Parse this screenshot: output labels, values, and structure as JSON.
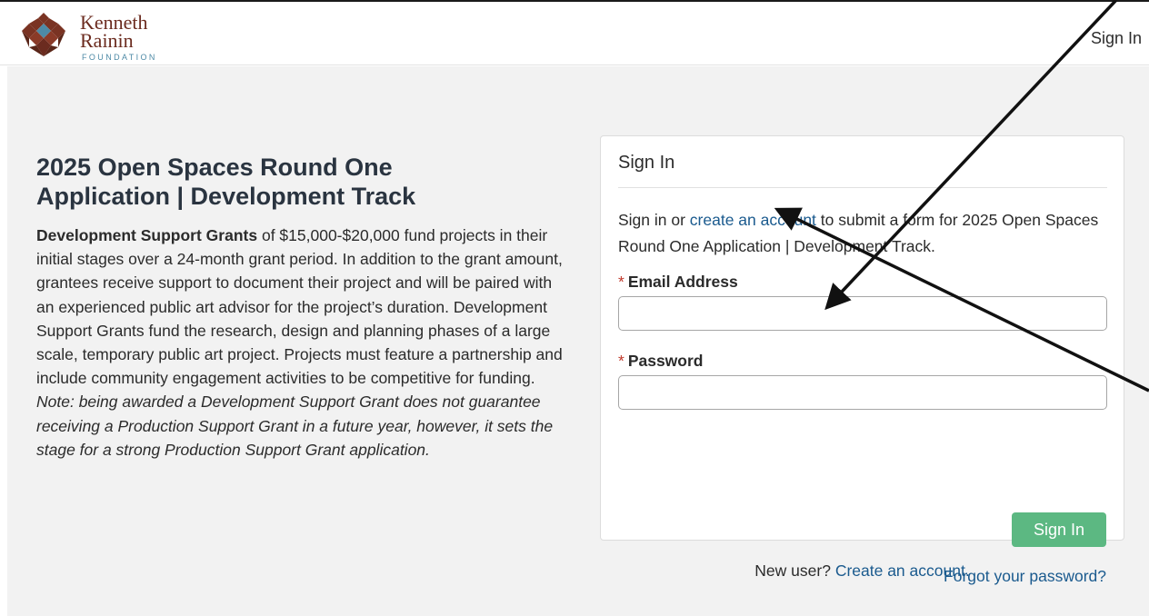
{
  "header": {
    "logo": {
      "line1": "Kenneth",
      "line2": "Rainin",
      "line3": "FOUNDATION"
    },
    "signin_link": "Sign In"
  },
  "main": {
    "title_line1": "2025 Open Spaces Round One",
    "title_line2": "Application | Development Track",
    "description": {
      "bold_lead": "Development Support Grants",
      "body": " of $15,000-$20,000 fund projects in their initial stages over a 24-month grant period. In addition to the grant amount, grantees receive support to document their project and will be paired with an experienced public art advisor for the project’s duration. Development Support Grants fund the research, design and planning phases of a large scale, temporary public art project. Projects must feature a partnership and include community engagement activities to be competitive for funding. ",
      "italic_note": "Note: being awarded a Development Support Grant does not guarantee receiving a Production Support Grant in a future year, however, it sets the stage for a strong Production Support Grant application."
    }
  },
  "signin_card": {
    "heading": "Sign In",
    "intro_prefix": "Sign in or ",
    "intro_link": "create an account",
    "intro_suffix": " to submit a form for 2025 Open Spaces Round One Application | Development Track.",
    "required_marker": "*",
    "email_label": "Email Address",
    "email_value": "",
    "password_label": "Password",
    "password_value": "",
    "submit_label": "Sign In",
    "forgot_label": "Forgot your password?"
  },
  "footer": {
    "new_user_prefix": "New user? ",
    "new_user_link": "Create an account."
  },
  "colors": {
    "accent_link": "#1a5a8e",
    "button_green": "#5cb882",
    "required_red": "#c0392b",
    "logo_brown": "#6b2b1f",
    "logo_blue": "#4e8aa6",
    "annotation_arrow": "#111111"
  }
}
